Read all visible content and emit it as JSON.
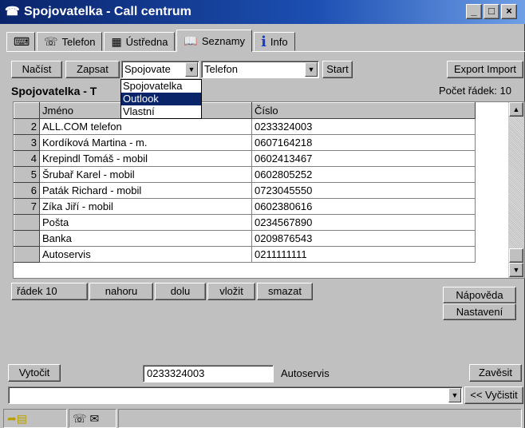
{
  "window": {
    "title": "Spojovatelka - Call centrum",
    "controls": [
      "_",
      "□",
      "×"
    ]
  },
  "tabs": [
    {
      "label": "",
      "icon": "keyboard-icon",
      "active": false
    },
    {
      "label": "Telefon",
      "icon": "telephone-icon",
      "active": false
    },
    {
      "label": "Ústředna",
      "icon": "switchboard-icon",
      "active": false
    },
    {
      "label": "Seznamy",
      "icon": "open-book-icon",
      "active": true
    },
    {
      "label": "Info",
      "icon": "info-icon",
      "active": false
    }
  ],
  "toolbar": {
    "load_label": "Načíst",
    "save_label": "Zapsat",
    "source_value": "Spojovate",
    "column_value": "Telefon",
    "start_label": "Start",
    "export_label": "Export",
    "import_label": "Import"
  },
  "dropdown": {
    "options": [
      "Spojovatelka",
      "Outlook",
      "Vlastní"
    ],
    "selected_index": 1
  },
  "list": {
    "caption": "Spojovatelka - T",
    "row_count": "Počet řádek: 10",
    "columns": [
      "Jméno",
      "Číslo"
    ],
    "rows": [
      {
        "num": "2",
        "name": "ALL.COM telefon",
        "number": "0233324003"
      },
      {
        "num": "3",
        "name": "Kordíková Martina - m.",
        "number": "0607164218"
      },
      {
        "num": "4",
        "name": "Krepindl Tomáš - mobil",
        "number": "0602413467"
      },
      {
        "num": "5",
        "name": "Šrubař Karel - mobil",
        "number": "0602805252"
      },
      {
        "num": "6",
        "name": "Paták Richard - mobil",
        "number": "0723045550"
      },
      {
        "num": "7",
        "name": "Zíka Jiří - mobil",
        "number": "0602380616"
      },
      {
        "num": "",
        "name": "Pošta",
        "number": "0234567890"
      },
      {
        "num": "",
        "name": "Banka",
        "number": "0209876543"
      },
      {
        "num": "",
        "name": "Autoservis",
        "number": "0211111111"
      }
    ]
  },
  "nav": {
    "row_label": "řádek 10",
    "up_label": "nahoru",
    "down_label": "dolu",
    "insert_label": "vložit",
    "delete_label": "smazat",
    "help_label": "Nápověda",
    "settings_label": "Nastavení"
  },
  "dial": {
    "dial_label": "Vytočit",
    "number_value": "0233324003",
    "contact_name": "Autoservis",
    "hangup_label": "Zavěsit",
    "clear_label": "<< Vyčistit",
    "message_value": ""
  },
  "statusbar": {
    "icons": [
      "transfer-icon",
      "telephone-icon",
      "envelope-icon"
    ]
  },
  "colors": {
    "titlebar": "#0a246a",
    "selection": "#0a246a",
    "face": "#c0c0c0"
  }
}
